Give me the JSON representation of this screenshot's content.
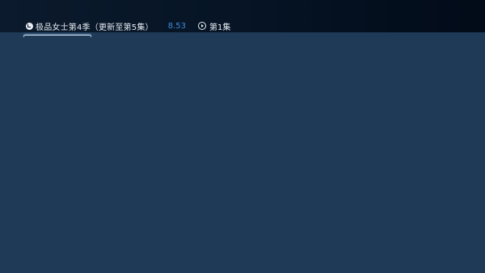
{
  "header": {
    "title": "极品女士第4季（更新至第5集）",
    "score": "8.53",
    "episode": "第1集",
    "icons": {
      "history": "history-icon",
      "play": "play-circle-icon"
    }
  },
  "colors": {
    "background": "#1f3a57",
    "top_bar": "#051324",
    "score": "#3d8bd9",
    "text": "#e6ebf1"
  }
}
